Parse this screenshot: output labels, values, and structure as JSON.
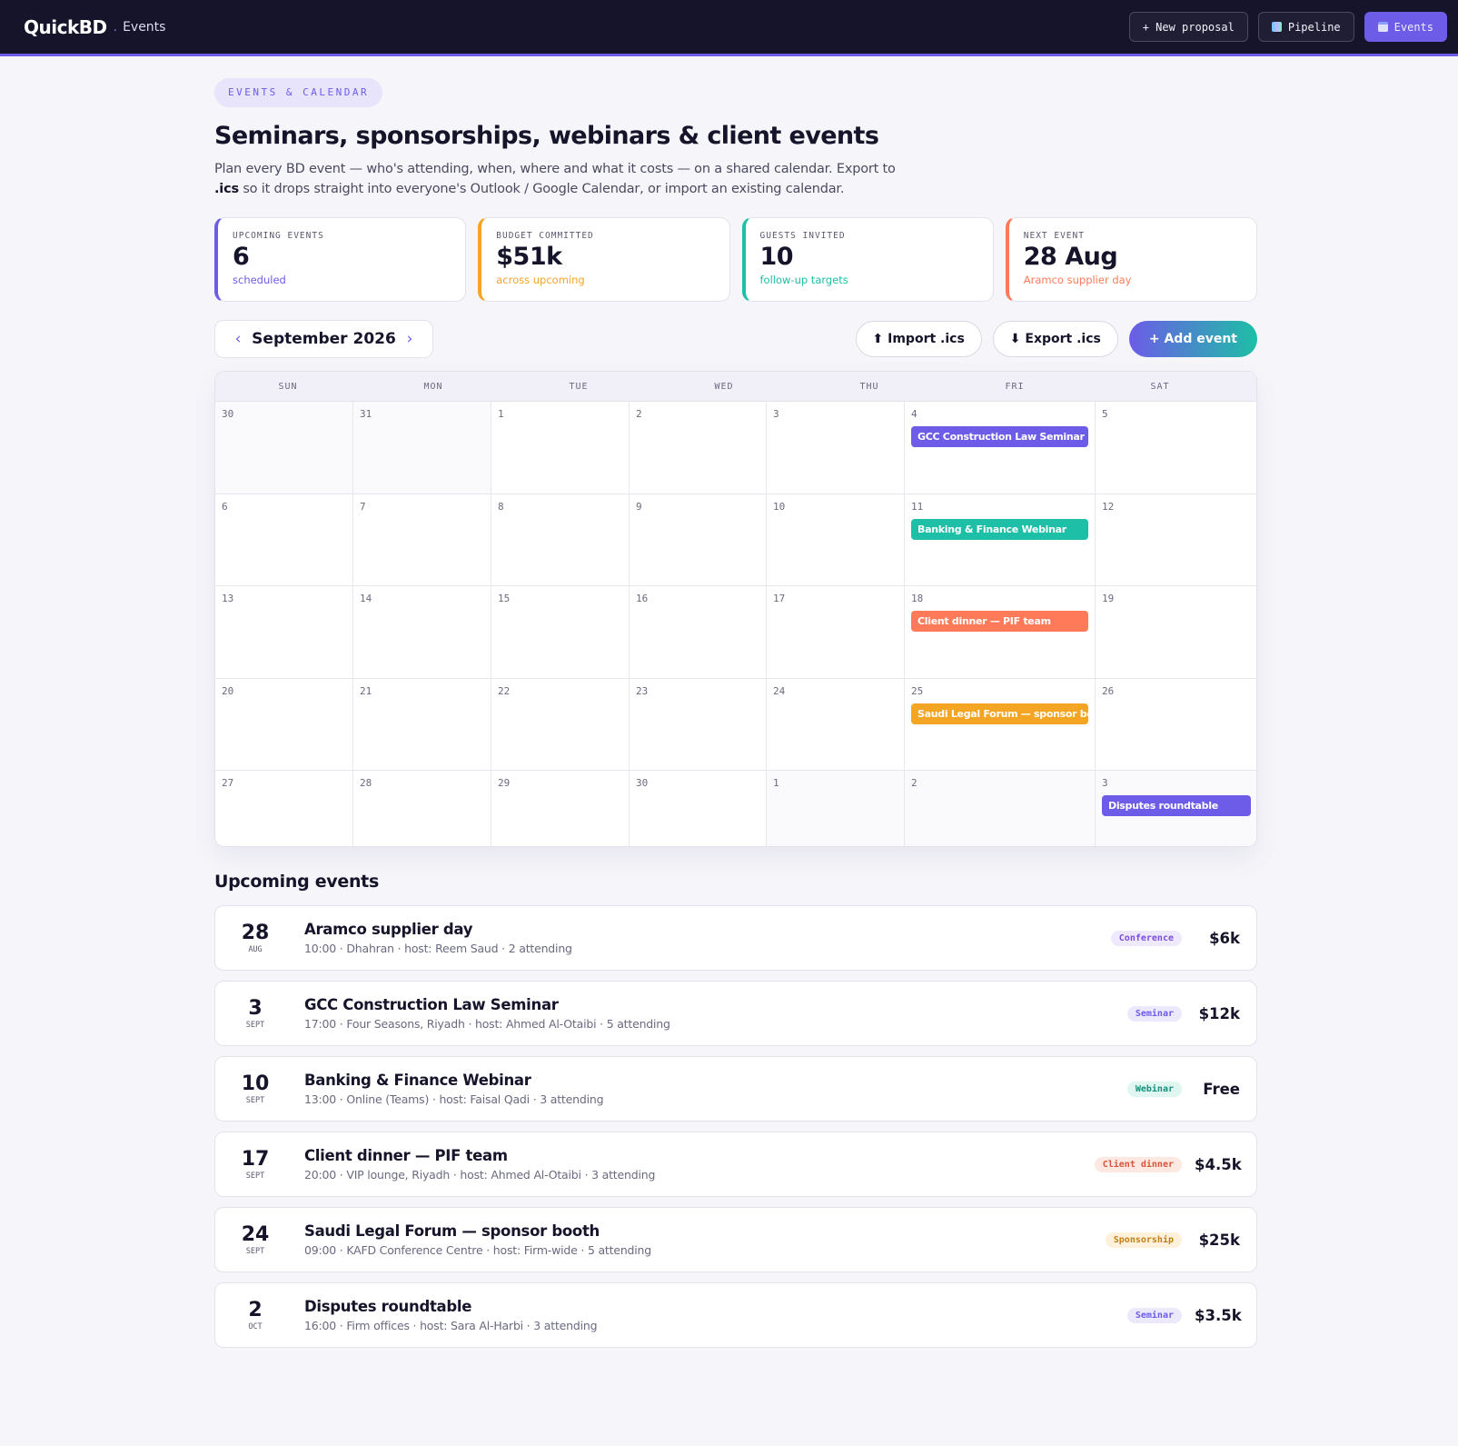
{
  "app": {
    "logo": "QuickBD",
    "separator": ".",
    "section": "Events",
    "actions": [
      {
        "label": "+ New proposal"
      },
      {
        "label": "Pipeline"
      },
      {
        "label": "Events"
      }
    ]
  },
  "header": {
    "pill": "EVENTS & CALENDAR",
    "title": "Seminars, sponsorships, webinars & client events",
    "subtitle_before": "Plan every BD event — who's attending, when, where and what it costs — on a shared calendar. Export to ",
    "subtitle_bold": ".ics",
    "subtitle_after": " so it drops straight into everyone's Outlook / Google Calendar, or import an existing calendar."
  },
  "stats": [
    {
      "label": "UPCOMING EVENTS",
      "value": "6",
      "note": "scheduled",
      "color": "#6c5ce7"
    },
    {
      "label": "BUDGET COMMITTED",
      "value": "$51k",
      "note": "across upcoming",
      "color": "#f5a524"
    },
    {
      "label": "GUESTS INVITED",
      "value": "10",
      "note": "follow-up targets",
      "color": "#1dbfa6"
    },
    {
      "label": "NEXT EVENT",
      "value": "28 Aug",
      "note": "Aramco supplier day",
      "color": "#ff7a59"
    }
  ],
  "calendar": {
    "prev": "‹",
    "next": "›",
    "month": "September 2026",
    "import": "⬆ Import .ics",
    "export": "⬇ Export .ics",
    "add": "+ Add event",
    "weekdays": [
      "SUN",
      "MON",
      "TUE",
      "WED",
      "THU",
      "FRI",
      "SAT"
    ],
    "weeks": [
      [
        {
          "d": "30",
          "out": true
        },
        {
          "d": "31",
          "out": true
        },
        {
          "d": "1"
        },
        {
          "d": "2"
        },
        {
          "d": "3"
        },
        {
          "d": "4",
          "event": "GCC Construction Law Seminar",
          "color": "#6c5ce7"
        },
        {
          "d": "5"
        }
      ],
      [
        {
          "d": "6"
        },
        {
          "d": "7"
        },
        {
          "d": "8"
        },
        {
          "d": "9"
        },
        {
          "d": "10"
        },
        {
          "d": "11",
          "event": "Banking & Finance Webinar",
          "color": "#1dbfa6"
        },
        {
          "d": "12"
        }
      ],
      [
        {
          "d": "13"
        },
        {
          "d": "14"
        },
        {
          "d": "15"
        },
        {
          "d": "16"
        },
        {
          "d": "17"
        },
        {
          "d": "18",
          "event": "Client dinner — PIF team",
          "color": "#ff7a59"
        },
        {
          "d": "19"
        }
      ],
      [
        {
          "d": "20"
        },
        {
          "d": "21"
        },
        {
          "d": "22"
        },
        {
          "d": "23"
        },
        {
          "d": "24"
        },
        {
          "d": "25",
          "event": "Saudi Legal Forum — sponsor booth",
          "color": "#f5a524"
        },
        {
          "d": "26"
        }
      ],
      [
        {
          "d": "27"
        },
        {
          "d": "28"
        },
        {
          "d": "29"
        },
        {
          "d": "30"
        },
        {
          "d": "1",
          "out": true
        },
        {
          "d": "2",
          "out": true
        },
        {
          "d": "3",
          "out": true,
          "event": "Disputes roundtable",
          "color": "#6c5ce7"
        }
      ]
    ]
  },
  "upcoming": {
    "title": "Upcoming events",
    "events": [
      {
        "day": "28",
        "mon": "AUG",
        "title": "Aramco supplier day",
        "meta": "10:00 · Dhahran · host: Reem Saud · 2 attending",
        "tag": "Conference",
        "tag_bg": "#efe9fd",
        "tag_fg": "#7c4dde",
        "price": "$6k"
      },
      {
        "day": "3",
        "mon": "SEPT",
        "title": "GCC Construction Law Seminar",
        "meta": "17:00 · Four Seasons, Riyadh · host: Ahmed Al-Otaibi · 5 attending",
        "tag": "Seminar",
        "tag_bg": "#ebe9fb",
        "tag_fg": "#6c5ce7",
        "price": "$12k"
      },
      {
        "day": "10",
        "mon": "SEPT",
        "title": "Banking & Finance Webinar",
        "meta": "13:00 · Online (Teams) · host: Faisal Qadi · 3 attending",
        "tag": "Webinar",
        "tag_bg": "#dff6f1",
        "tag_fg": "#13917d",
        "price": "Free"
      },
      {
        "day": "17",
        "mon": "SEPT",
        "title": "Client dinner — PIF team",
        "meta": "20:00 · VIP lounge, Riyadh · host: Ahmed Al-Otaibi · 3 attending",
        "tag": "Client dinner",
        "tag_bg": "#fde8e2",
        "tag_fg": "#d9543a",
        "price": "$4.5k"
      },
      {
        "day": "24",
        "mon": "SEPT",
        "title": "Saudi Legal Forum — sponsor booth",
        "meta": "09:00 · KAFD Conference Centre · host: Firm-wide · 5 attending",
        "tag": "Sponsorship",
        "tag_bg": "#fdf1dc",
        "tag_fg": "#c17f0e",
        "price": "$25k"
      },
      {
        "day": "2",
        "mon": "OCT",
        "title": "Disputes roundtable",
        "meta": "16:00 · Firm offices · host: Sara Al-Harbi · 3 attending",
        "tag": "Seminar",
        "tag_bg": "#ebe9fb",
        "tag_fg": "#6c5ce7",
        "price": "$3.5k"
      }
    ]
  }
}
